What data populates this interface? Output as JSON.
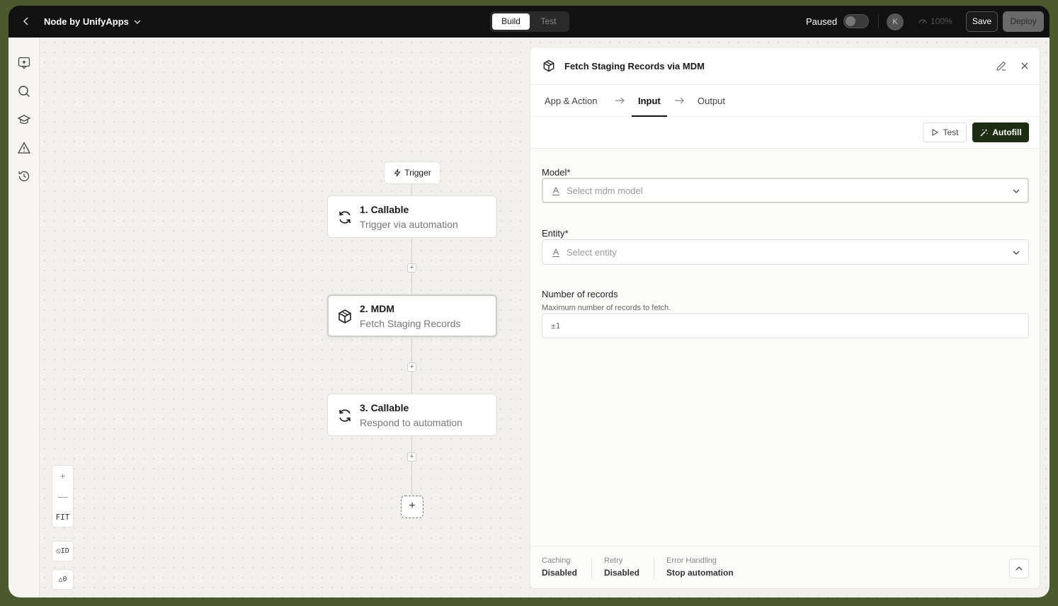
{
  "topbar": {
    "app_title": "Node by UnifyApps",
    "modes": [
      "Build",
      "Test"
    ],
    "active_mode": "Build",
    "paused_label": "Paused",
    "avatar_initial": "K",
    "zoom": "100%",
    "save_label": "Save",
    "deploy_label": "Deploy"
  },
  "rail": {
    "icons": [
      "ai-chat-icon",
      "search-icon",
      "learn-icon",
      "warning-icon",
      "history-icon"
    ]
  },
  "canvas": {
    "trigger_label": "Trigger",
    "nodes": [
      {
        "title": "1. Callable",
        "subtitle": "Trigger via automation",
        "icon": "refresh-icon"
      },
      {
        "title": "2. MDM",
        "subtitle": "Fetch Staging Records",
        "icon": "box-icon",
        "selected": true
      },
      {
        "title": "3. Callable",
        "subtitle": "Respond to automation",
        "icon": "refresh-icon"
      }
    ],
    "zoom_in": "+",
    "zoom_out": "—",
    "fit_label": "FIT",
    "id_toggle": "ID",
    "warnings_count": "0"
  },
  "panel": {
    "title": "Fetch Staging Records via MDM",
    "tabs": [
      "App & Action",
      "Input",
      "Output"
    ],
    "active_tab": "Input",
    "test_label": "Test",
    "autofill_label": "Autofill",
    "fields": {
      "model_label": "Model*",
      "model_placeholder": "Select mdm model",
      "entity_label": "Entity*",
      "entity_placeholder": "Select entity",
      "records_label": "Number of records",
      "records_hint": "Maximum number of records to fetch.",
      "records_type_icon": "±1"
    },
    "footer": {
      "caching_label": "Caching",
      "caching_value": "Disabled",
      "retry_label": "Retry",
      "retry_value": "Disabled",
      "error_label": "Error Handling",
      "error_value": "Stop automation"
    }
  }
}
